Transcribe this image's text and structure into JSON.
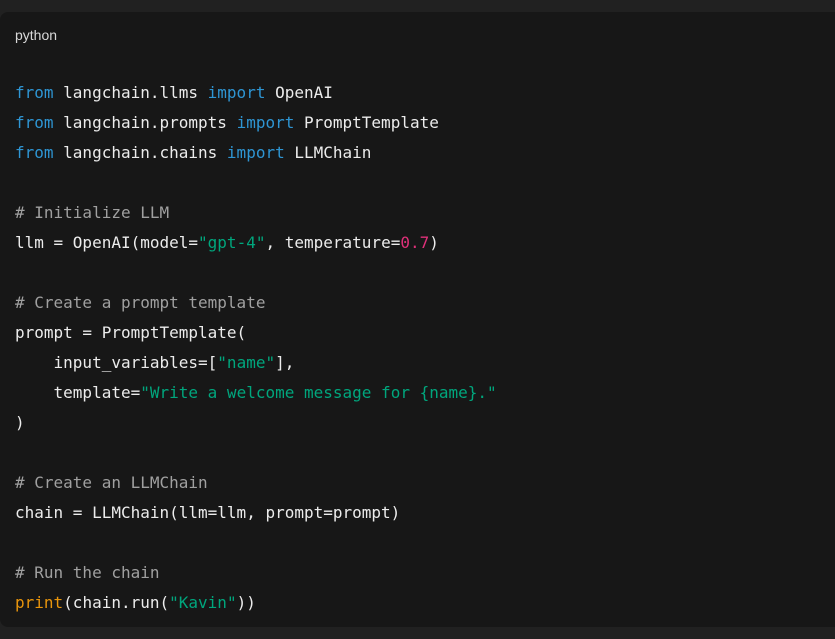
{
  "code_block": {
    "language": "python",
    "lines": [
      [
        {
          "t": "kw",
          "v": "from"
        },
        {
          "t": "pl",
          "v": " langchain.llms "
        },
        {
          "t": "kw",
          "v": "import"
        },
        {
          "t": "pl",
          "v": " OpenAI"
        }
      ],
      [
        {
          "t": "kw",
          "v": "from"
        },
        {
          "t": "pl",
          "v": " langchain.prompts "
        },
        {
          "t": "kw",
          "v": "import"
        },
        {
          "t": "pl",
          "v": " PromptTemplate"
        }
      ],
      [
        {
          "t": "kw",
          "v": "from"
        },
        {
          "t": "pl",
          "v": " langchain.chains "
        },
        {
          "t": "kw",
          "v": "import"
        },
        {
          "t": "pl",
          "v": " LLMChain"
        }
      ],
      [],
      [
        {
          "t": "cm",
          "v": "# Initialize LLM"
        }
      ],
      [
        {
          "t": "pl",
          "v": "llm = OpenAI(model="
        },
        {
          "t": "str",
          "v": "\"gpt-4\""
        },
        {
          "t": "pl",
          "v": ", temperature="
        },
        {
          "t": "num",
          "v": "0.7"
        },
        {
          "t": "pl",
          "v": ")"
        }
      ],
      [],
      [
        {
          "t": "cm",
          "v": "# Create a prompt template"
        }
      ],
      [
        {
          "t": "pl",
          "v": "prompt = PromptTemplate("
        }
      ],
      [
        {
          "t": "pl",
          "v": "    input_variables=["
        },
        {
          "t": "str",
          "v": "\"name\""
        },
        {
          "t": "pl",
          "v": "],"
        }
      ],
      [
        {
          "t": "pl",
          "v": "    template="
        },
        {
          "t": "str",
          "v": "\"Write a welcome message for {name}.\""
        }
      ],
      [
        {
          "t": "pl",
          "v": ")"
        }
      ],
      [],
      [
        {
          "t": "cm",
          "v": "# Create an LLMChain"
        }
      ],
      [
        {
          "t": "pl",
          "v": "chain = LLMChain(llm=llm, prompt=prompt)"
        }
      ],
      [],
      [
        {
          "t": "cm",
          "v": "# Run the chain"
        }
      ],
      [
        {
          "t": "fn",
          "v": "print"
        },
        {
          "t": "pl",
          "v": "(chain.run("
        },
        {
          "t": "str",
          "v": "\"Kavin\""
        },
        {
          "t": "pl",
          "v": "))"
        }
      ]
    ]
  },
  "colors": {
    "keyword": "#2e95d3",
    "string": "#00a67d",
    "number": "#df3079",
    "comment": "#a0a0a0",
    "builtin": "#e9950c",
    "text": "#ececec",
    "background": "#171717"
  }
}
